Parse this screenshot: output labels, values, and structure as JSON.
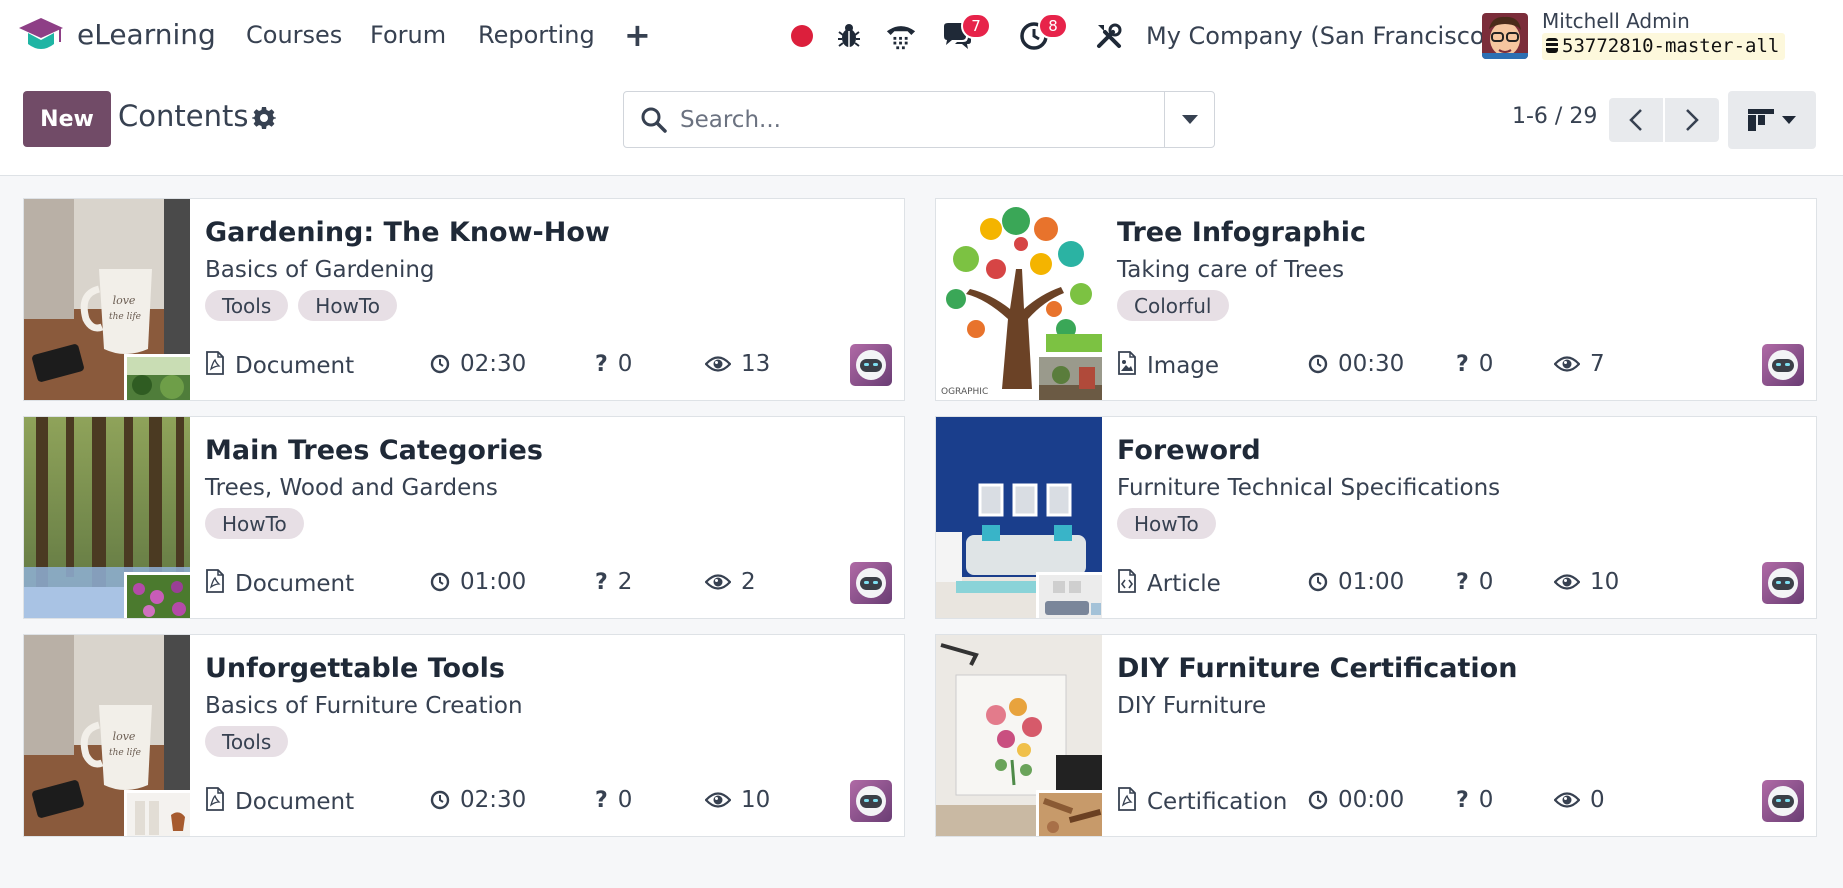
{
  "navbar": {
    "app_name": "eLearning",
    "menu": [
      "Courses",
      "Forum",
      "Reporting"
    ],
    "messages_badge": "7",
    "activities_badge": "8",
    "company": "My Company (San Francisco)",
    "user_name": "Mitchell Admin",
    "database": "53772810-master-all"
  },
  "control": {
    "new_label": "New",
    "title": "Contents",
    "search_placeholder": "Search...",
    "pager": "1-6 / 29"
  },
  "colors": {
    "brand": "#714b67",
    "tag_bg": "#e7dfe5",
    "badge": "#e7234a",
    "recording_dot": "#dc1f3c"
  },
  "cards": [
    {
      "title": "Gardening: The Know-How",
      "subtitle": "Basics of Gardening",
      "tags": [
        "Tools",
        "HowTo"
      ],
      "type_icon": "pdf-icon",
      "type": "Document",
      "duration": "02:30",
      "questions": "0",
      "views": "13",
      "image": "coffee-mug-photo",
      "thumb": "garden-photo"
    },
    {
      "title": "Tree Infographic",
      "subtitle": "Taking care of Trees",
      "tags": [
        "Colorful"
      ],
      "type_icon": "image-icon",
      "type": "Image",
      "duration": "00:30",
      "questions": "0",
      "views": "7",
      "image": "tree-infographic-photo",
      "thumb": "gardening-tools-photo"
    },
    {
      "title": "Main Trees Categories",
      "subtitle": "Trees, Wood and Gardens",
      "tags": [
        "HowTo"
      ],
      "type_icon": "pdf-icon",
      "type": "Document",
      "duration": "01:00",
      "questions": "2",
      "views": "2",
      "image": "forest-photo",
      "thumb": "flowers-photo"
    },
    {
      "title": "Foreword",
      "subtitle": "Furniture Technical Specifications",
      "tags": [
        "HowTo"
      ],
      "type_icon": "code-file-icon",
      "type": "Article",
      "duration": "01:00",
      "questions": "0",
      "views": "10",
      "image": "living-room-photo",
      "thumb": "interior-photo"
    },
    {
      "title": "Unforgettable Tools",
      "subtitle": "Basics of Furniture Creation",
      "tags": [
        "Tools"
      ],
      "type_icon": "pdf-icon",
      "type": "Document",
      "duration": "02:30",
      "questions": "0",
      "views": "10",
      "image": "coffee-mug-photo",
      "thumb": "chairs-photo"
    },
    {
      "title": "DIY Furniture Certification",
      "subtitle": "DIY Furniture",
      "tags": [],
      "type_icon": "pdf-icon",
      "type": "Certification",
      "duration": "00:00",
      "questions": "0",
      "views": "0",
      "image": "flower-painting-photo",
      "thumb": "woodwork-tools-photo"
    }
  ]
}
